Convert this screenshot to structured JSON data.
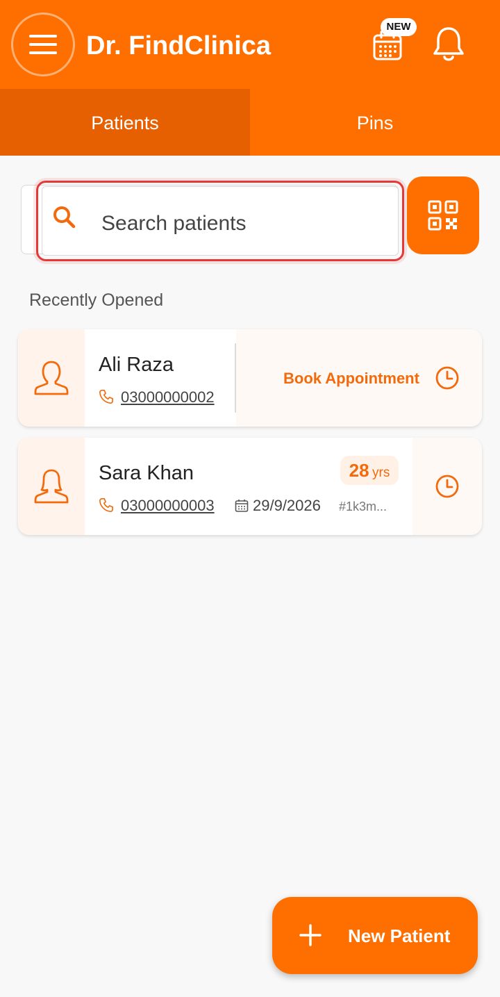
{
  "appbar": {
    "title": "Dr. FindClinica",
    "new_badge": "NEW",
    "icons": [
      "menu-icon",
      "calendar-icon",
      "bell-icon"
    ],
    "accent_color": "#ff6f00"
  },
  "tabs": [
    {
      "label": "Patients",
      "active": true
    },
    {
      "label": "Pins",
      "active": false
    }
  ],
  "search": {
    "placeholder": "Search patients",
    "value": ""
  },
  "section": {
    "recently_opened": "Recently Opened"
  },
  "patients": [
    {
      "name": "Ali Raza",
      "phone": "03000000002",
      "action_label": "Book Appointment"
    },
    {
      "name": "Sara Khan",
      "phone": "03000000003",
      "age": "28",
      "age_unit": "yrs",
      "date": "29/9/2026",
      "id": "#1k3m..."
    }
  ],
  "fab": {
    "label": "New Patient"
  }
}
